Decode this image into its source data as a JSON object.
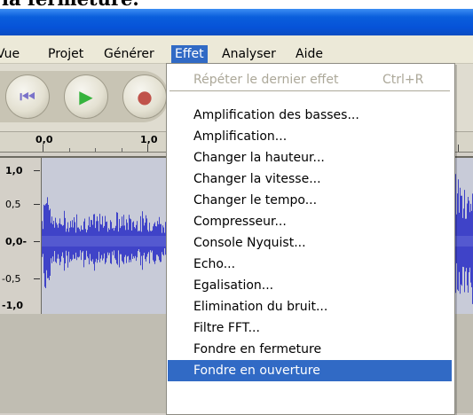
{
  "page": {
    "heading": "la fermeture."
  },
  "menubar": {
    "items": [
      {
        "label": "Vue",
        "active": false
      },
      {
        "label": "Projet",
        "active": false
      },
      {
        "label": "Générer",
        "active": false
      },
      {
        "label": "Effet",
        "active": true
      },
      {
        "label": "Analyser",
        "active": false
      },
      {
        "label": "Aide",
        "active": false
      }
    ]
  },
  "toolbar": {
    "buttons": [
      {
        "name": "skip-to-start-icon",
        "glyph": "⏮",
        "color": "#7a72c9"
      },
      {
        "name": "play-icon",
        "glyph": "▶",
        "color": "#36b33d"
      },
      {
        "name": "record-icon",
        "glyph": "●",
        "color": "#c0524a"
      }
    ]
  },
  "ruler": {
    "labels": [
      "0,0",
      "1,0"
    ]
  },
  "track": {
    "scale_labels": [
      "1,0",
      "0,5",
      "0,0-",
      "-0,5",
      "-1,0"
    ],
    "wave_color": "#3f43c8",
    "wave_bg": "#c8cbd8"
  },
  "effect_menu": {
    "items": [
      {
        "label": "Répéter le dernier effet",
        "shortcut": "Ctrl+R",
        "disabled": true,
        "highlighted": false
      },
      {
        "label": "Amplification des basses...",
        "shortcut": "",
        "disabled": false,
        "highlighted": false
      },
      {
        "label": "Amplification...",
        "shortcut": "",
        "disabled": false,
        "highlighted": false
      },
      {
        "label": "Changer la hauteur...",
        "shortcut": "",
        "disabled": false,
        "highlighted": false
      },
      {
        "label": "Changer la vitesse...",
        "shortcut": "",
        "disabled": false,
        "highlighted": false
      },
      {
        "label": "Changer le tempo...",
        "shortcut": "",
        "disabled": false,
        "highlighted": false
      },
      {
        "label": "Compresseur...",
        "shortcut": "",
        "disabled": false,
        "highlighted": false
      },
      {
        "label": "Console Nyquist...",
        "shortcut": "",
        "disabled": false,
        "highlighted": false
      },
      {
        "label": "Echo...",
        "shortcut": "",
        "disabled": false,
        "highlighted": false
      },
      {
        "label": "Egalisation...",
        "shortcut": "",
        "disabled": false,
        "highlighted": false
      },
      {
        "label": "Elimination du bruit...",
        "shortcut": "",
        "disabled": false,
        "highlighted": false
      },
      {
        "label": "Filtre FFT...",
        "shortcut": "",
        "disabled": false,
        "highlighted": false
      },
      {
        "label": "Fondre en fermeture",
        "shortcut": "",
        "disabled": false,
        "highlighted": false
      },
      {
        "label": "Fondre en ouverture",
        "shortcut": "",
        "disabled": false,
        "highlighted": true
      }
    ],
    "highlight_color": "#316ac5"
  }
}
